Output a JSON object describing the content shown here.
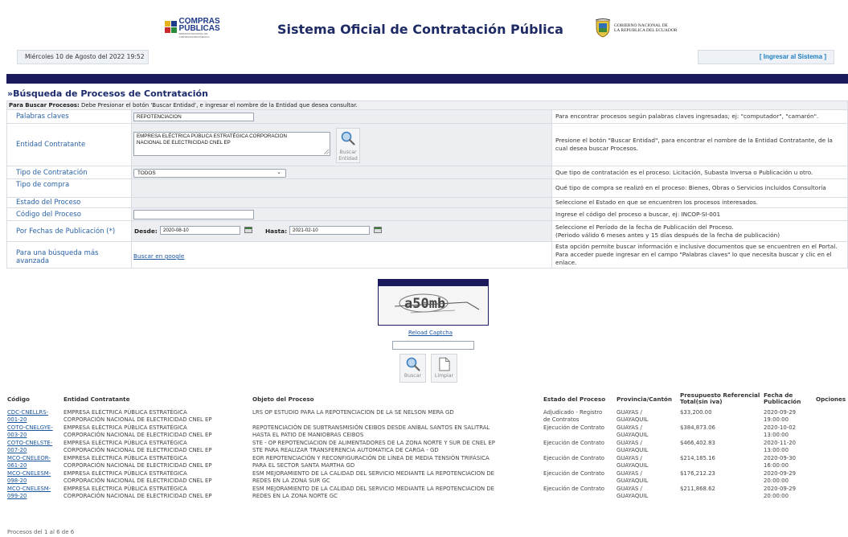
{
  "header": {
    "compras_logo_line1": "COMPRAS",
    "compras_logo_line2": "PÚBLICAS",
    "compras_logo_tag": "SERVICIO NACIONAL DE CONTRATACIÓN PÚBLICA",
    "site_title": "Sistema Oficial de Contratación Pública",
    "gov_logo_line1": "GOBIERNO NACIONAL DE",
    "gov_logo_line2": "LA REPUBLICA DEL ECUADOR",
    "date": "Miércoles 10 de Agosto del 2022 19:52",
    "login_link": "[ Ingresar al Sistema ]"
  },
  "form": {
    "title": "»Búsqueda de Procesos de Contratación",
    "instruction_bold": "Para Buscar Procesos:",
    "instruction": " Debe Presionar el botón 'Buscar Entidad', e ingresar el nombre de la Entidad que desea consultar.",
    "rows": {
      "keywords": {
        "label": "Palabras claves",
        "value": "REPOTENCIACION",
        "help": "Para encontrar procesos según palabras claves ingresadas; ej: \"computador\", \"camarón\"."
      },
      "entity": {
        "label": "Entidad Contratante",
        "value_line1": "EMPRESA ELÉCTRICA PÚBLICA ESTRATÉGICA CORPORACION",
        "value_line2": "NACIONAL DE ELECTRICIDAD CNEL EP",
        "button_line1": "Buscar",
        "button_line2": "Entidad",
        "help": "Presione el botón \"Buscar Entidad\", para encontrar el nombre de la Entidad Contratante, de la cual desea buscar Procesos."
      },
      "contract_type": {
        "label": "Tipo de Contratación",
        "value": "TODOS",
        "help": "Que tipo de contratación es el proceso: Licitación, Subasta Inversa o Publicación u otro."
      },
      "purchase_type": {
        "label": "Tipo de compra",
        "help": "Qué tipo de compra se realizó en el proceso: Bienes, Obras o Servicios incluidos Consultoría"
      },
      "status": {
        "label": "Estado del Proceso",
        "help": "Seleccione el Estado en que se encuentren los procesos interesados."
      },
      "code": {
        "label": "Código del Proceso",
        "value": "",
        "help": "Ingrese el código del proceso a buscar, ej: INCOP-SI-001"
      },
      "dates": {
        "label": "Por Fechas de Publicación (*)",
        "from_label": "Desde:",
        "from_value": "2020-08-10",
        "to_label": "Hasta:",
        "to_value": "2021-02-10",
        "help_line1": "Seleccione el Período de la fecha de Publicación del Proceso.",
        "help_line2": "(Periodo válido 6 meses antes y 15 días después de la fecha de publicación)"
      },
      "advanced": {
        "label_line1": "Para una búsqueda más",
        "label_line2": "avanzada",
        "link": "Buscar en google",
        "help": "Esta opción permite buscar información e inclusive documentos que se encuentren en el Portal. Para acceder puede ingresar en el campo \"Palabras claves\" lo que necesita buscar y clic en el enlace."
      }
    },
    "captcha_text": "a50mb",
    "reload_captcha": "Reload Captcha",
    "search_button": "Buscar",
    "clear_button": "Limpiar"
  },
  "results": {
    "headers": {
      "code": "Código",
      "entity": "Entidad Contratante",
      "object": "Objeto del Proceso",
      "status": "Estado del Proceso",
      "province": "Provincia/Cantón",
      "budget_line1": "Presupuesto Referencial",
      "budget_line2": "Total(sin iva)",
      "date_line1": "Fecha de",
      "date_line2": "Publicación",
      "options": "Opciones"
    },
    "rows": [
      {
        "code1": "CDC-CNELLRS-",
        "code2": "001-20",
        "entity1": "EMPRESA ELÉCTRICA PÚBLICA ESTRATÉGICA",
        "entity2": "CORPORACIÓN NACIONAL DE ELECTRICIDAD CNEL EP",
        "object1": "LRS OP ESTUDIO PARA LA REPOTENCIACION DE LA SE NELSON MERA GD",
        "object2": "",
        "status1": "Adjudicado - Registro",
        "status2": "de Contratos",
        "prov1": "GUAYAS /",
        "prov2": "GUAYAQUIL",
        "budget": "$33,200.00",
        "date1": "2020-09-29",
        "date2": "19:00:00"
      },
      {
        "code1": "COTO-CNELGYE-",
        "code2": "003-20",
        "entity1": "EMPRESA ELÉCTRICA PÚBLICA ESTRATÉGICA",
        "entity2": "CORPORACIÓN NACIONAL DE ELECTRICIDAD CNEL EP",
        "object1": "REPOTENCIACIÓN DE SUBTRANSMISIÓN CEIBOS DESDE ANÍBAL SANTOS EN SALITRAL",
        "object2": "HASTA EL PATIO DE MANIOBRAS CEIBOS",
        "status1": "Ejecución de Contrato",
        "status2": "",
        "prov1": "GUAYAS /",
        "prov2": "GUAYAQUIL",
        "budget": "$384,873.06",
        "date1": "2020-10-02",
        "date2": "13:00:00"
      },
      {
        "code1": "COTO-CNELSTE-",
        "code2": "007-20",
        "entity1": "EMPRESA ELÉCTRICA PÚBLICA ESTRATÉGICA",
        "entity2": "CORPORACIÓN NACIONAL DE ELECTRICIDAD CNEL EP",
        "object1": "STE - OP REPOTENCIACION DE ALIMENTADORES DE LA ZONA NORTE Y SUR DE CNEL EP",
        "object2": "STE PARA REALIZAR TRANSFERENCIA AUTOMATICA DE CARGA - GD",
        "status1": "Ejecución de Contrato",
        "status2": "",
        "prov1": "GUAYAS /",
        "prov2": "GUAYAQUIL",
        "budget": "$466,402.83",
        "date1": "2020-11-20",
        "date2": "13:00:00"
      },
      {
        "code1": "MCO-CNELEOR-",
        "code2": "061-20",
        "entity1": "EMPRESA ELÉCTRICA PÚBLICA ESTRATÉGICA",
        "entity2": "CORPORACIÓN NACIONAL DE ELECTRICIDAD CNEL EP",
        "object1": "EOR REPOTENCIACIÓN Y RECONFIGURACIÓN DE LÍNEA DE MEDIA TENSIÓN TRIFÁSICA",
        "object2": "PARA EL SECTOR SANTA MARTHA GD",
        "status1": "Ejecución de Contrato",
        "status2": "",
        "prov1": "GUAYAS /",
        "prov2": "GUAYAQUIL",
        "budget": "$214,185.16",
        "date1": "2020-09-30",
        "date2": "16:00:00"
      },
      {
        "code1": "MCO-CNELESM-",
        "code2": "098-20",
        "entity1": "EMPRESA ELÉCTRICA PÚBLICA ESTRATÉGICA",
        "entity2": "CORPORACIÓN NACIONAL DE ELECTRICIDAD CNEL EP",
        "object1": "ESM MEJORAMIENTO DE LA CALIDAD DEL SERVICIO MEDIANTE LA REPOTENCIACION DE",
        "object2": "REDES EN LA ZONA SUR GC",
        "status1": "Ejecución de Contrato",
        "status2": "",
        "prov1": "GUAYAS /",
        "prov2": "GUAYAQUIL",
        "budget": "$176,212.23",
        "date1": "2020-09-29",
        "date2": "20:00:00"
      },
      {
        "code1": "MCO-CNELESM-",
        "code2": "099-20",
        "entity1": "EMPRESA ELÉCTRICA PÚBLICA ESTRATÉGICA",
        "entity2": "CORPORACIÓN NACIONAL DE ELECTRICIDAD CNEL EP",
        "object1": "ESM MEJORAMIENTO DE LA CALIDAD DEL SERVICIO MEDIANTE LA REPOTENCIACION DE",
        "object2": "REDES EN LA ZONA NORTE GC",
        "status1": "Ejecución de Contrato",
        "status2": "",
        "prov1": "GUAYAS /",
        "prov2": "GUAYAQUIL",
        "budget": "$211,868.62",
        "date1": "2020-09-29",
        "date2": "20:00:00"
      }
    ],
    "count": "Procesos del 1 al 6 de 6"
  },
  "colors": {
    "navy": "#1a1a5c",
    "label_blue": "#2a63a6",
    "link_blue": "#1a55a0",
    "title_navy": "#1f2b64"
  }
}
